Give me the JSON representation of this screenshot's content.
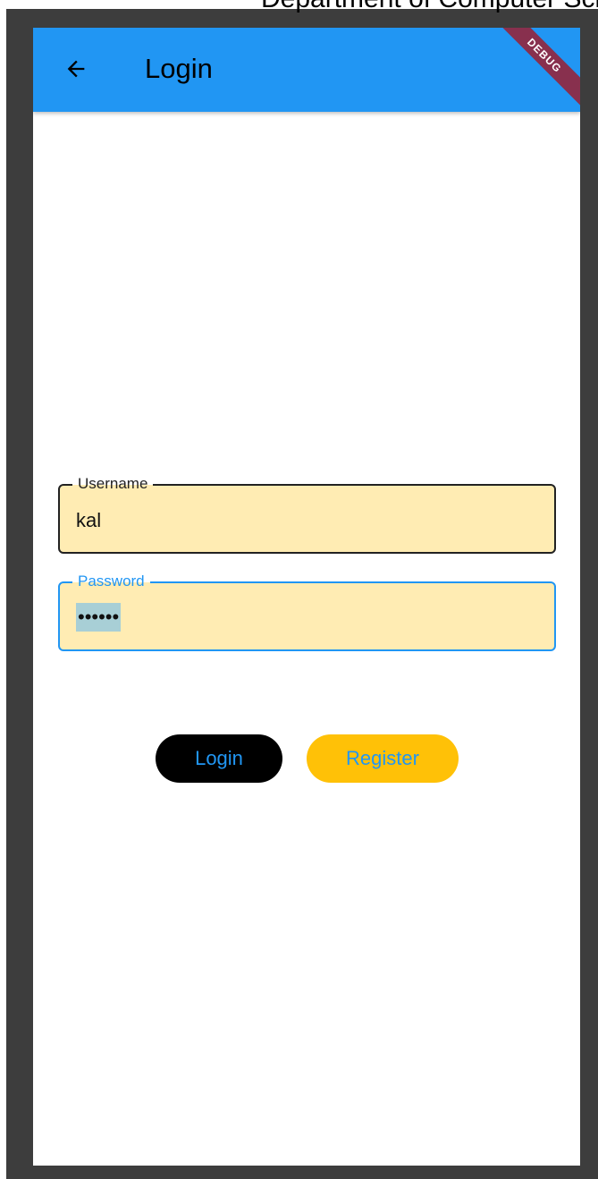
{
  "header_overflow_text": "Department of Computer Science",
  "appbar": {
    "title": "Login",
    "back_icon": "arrow-back-icon",
    "color": "#2196f3"
  },
  "debug_banner": {
    "label": "DEBUG",
    "color": "#88304e"
  },
  "form": {
    "username": {
      "label": "Username",
      "value": "kal"
    },
    "password": {
      "label": "Password",
      "masked_value": "••••••"
    },
    "field_fill": "#ffecb3"
  },
  "buttons": {
    "login_label": "Login",
    "register_label": "Register",
    "login_bg": "#000000",
    "register_bg": "#ffc107",
    "text_color": "#2196f3"
  }
}
